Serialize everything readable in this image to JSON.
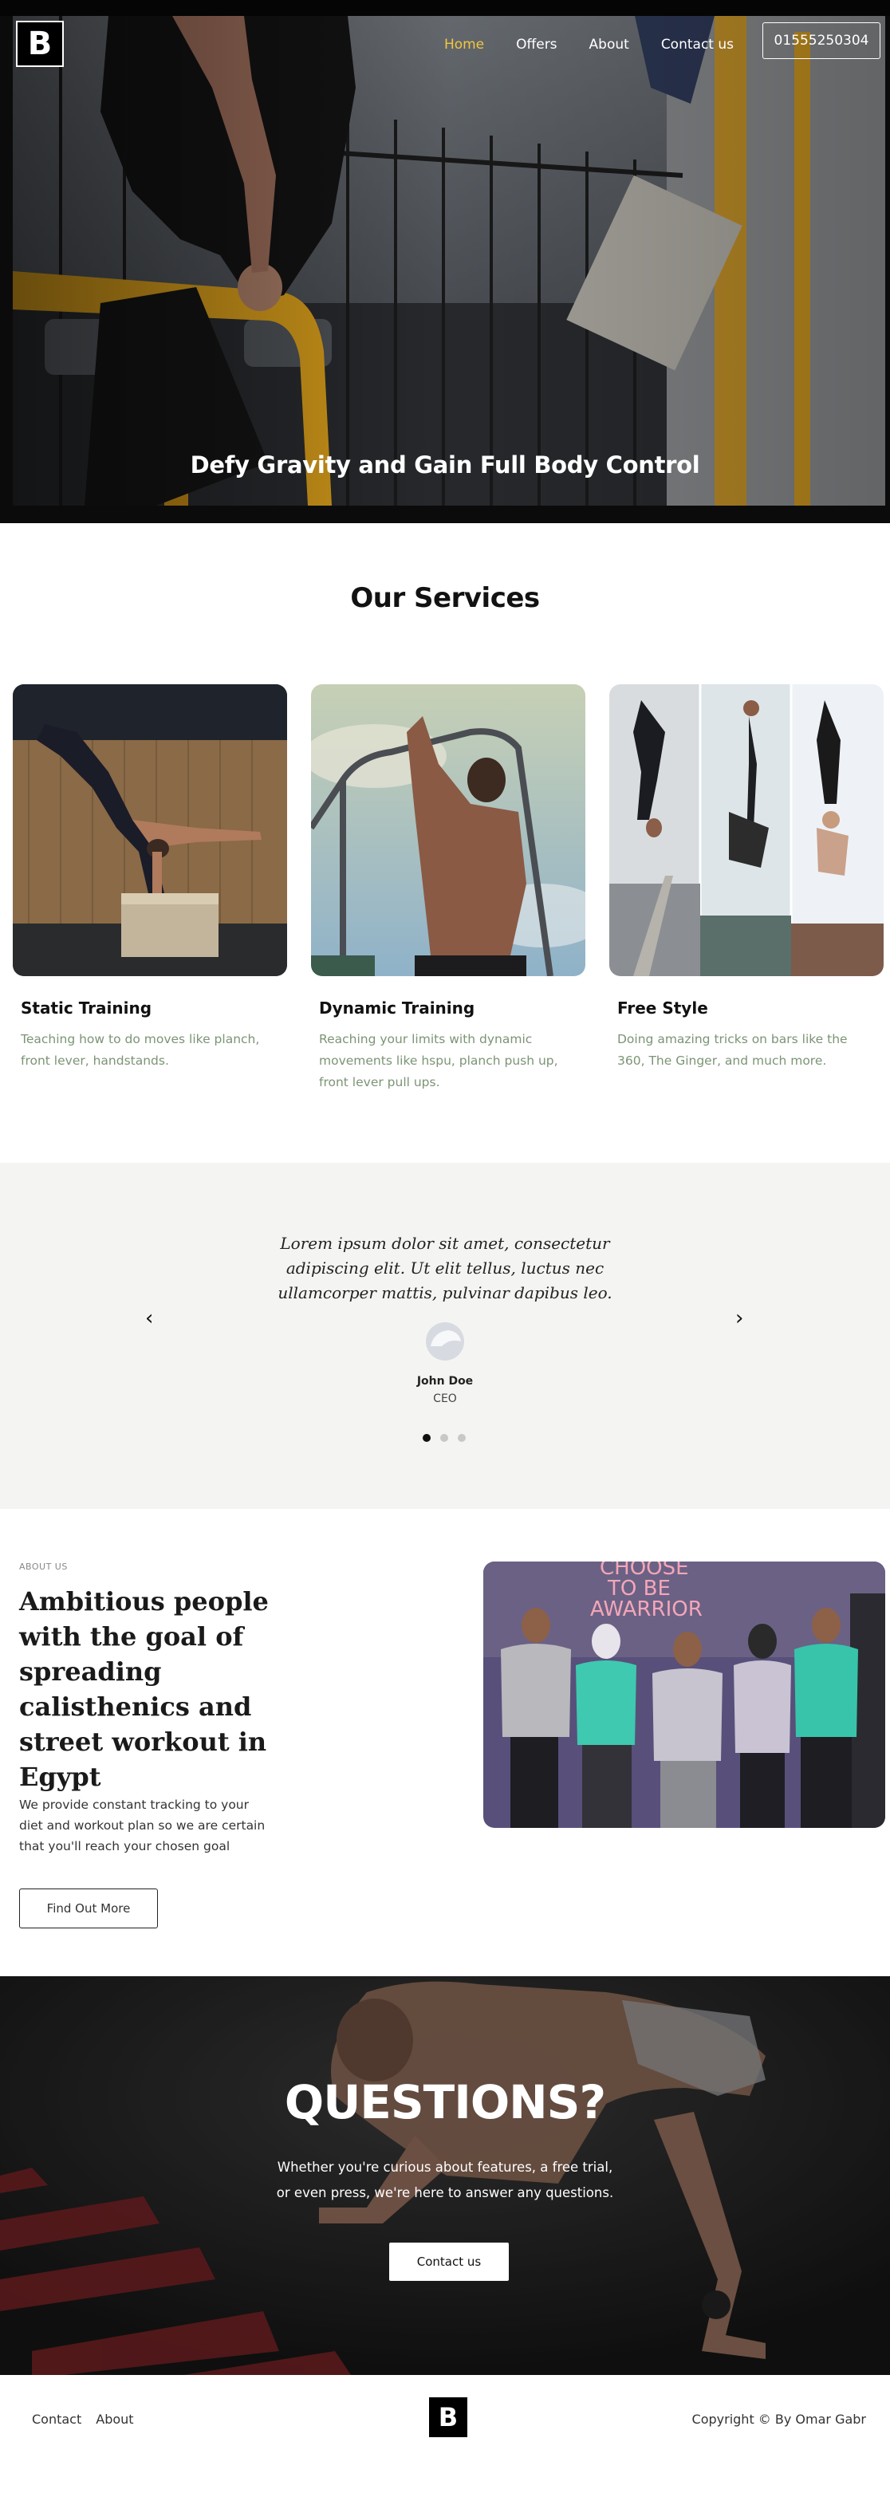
{
  "brand": {
    "logo_letter": "B"
  },
  "nav": {
    "items": [
      "Home",
      "Offers",
      "About",
      "Contact us"
    ],
    "active_index": 0,
    "phone": "01555250304",
    "active_color": "#f2c640"
  },
  "hero": {
    "title": "Defy Gravity and Gain Full Body Control"
  },
  "services": {
    "title": "Our Services",
    "items": [
      {
        "name": "Static Training",
        "description": "Teaching how to do moves like planch, front lever, handstands."
      },
      {
        "name": "Dynamic Training",
        "description": "Reaching your limits with dynamic movements like hspu, planch push up, front lever pull ups."
      },
      {
        "name": "Free Style",
        "description": "Doing amazing tricks on bars like the 360, The Ginger, and much more."
      }
    ]
  },
  "testimonial": {
    "quote": "Lorem ipsum dolor sit amet, consectetur adipiscing elit. Ut elit tellus, luctus nec ullamcorper mattis, pulvinar dapibus leo.",
    "name": "John Doe",
    "role": "CEO",
    "prev": "‹",
    "next": "›",
    "slide_count": 3,
    "active_slide": 0
  },
  "about": {
    "eyebrow": "ABOUT US",
    "heading": "Ambitious people with the goal of spreading calisthenics and street workout in Egypt",
    "body": "We provide constant tracking to your diet and workout plan so we are certain that you'll reach your chosen goal",
    "button": "Find Out More",
    "sign_text": [
      "CHOOSE",
      "TO BE",
      "AWARRIOR"
    ]
  },
  "questions": {
    "title": "QUESTIONS?",
    "text": "Whether you're curious about features, a free trial, or even press, we're here to answer any questions.",
    "button": "Contact us"
  },
  "footer": {
    "links": [
      "Contact",
      "About"
    ],
    "logo_letter": "B",
    "copyright": "Copyright © By Omar Gabr"
  }
}
